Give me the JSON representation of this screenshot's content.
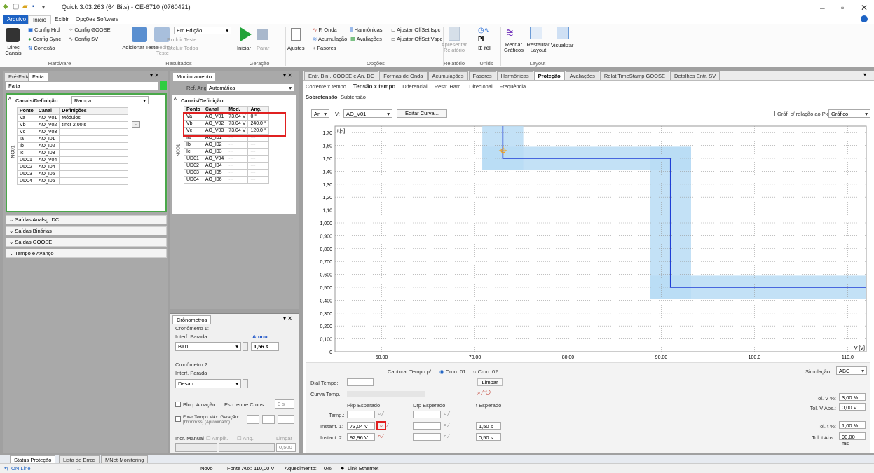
{
  "title_bar": {
    "title": "Quick 3.03.263 (64 Bits) - CE-6710 (0760421)"
  },
  "menu": {
    "items": [
      "Arquivo",
      "Início",
      "Exibir",
      "Opções Software"
    ]
  },
  "ribbon": {
    "hardware": {
      "config_hrd": "Config Hrd",
      "config_goose": "Config GOOSE",
      "config_sync": "Config Sync",
      "config_sv": "Config SV",
      "direc_canais": "Direc Canais",
      "conexao": "Conexão",
      "label": "Hardware"
    },
    "resultados": {
      "adicionar": "Adicionar Teste",
      "reeditar": "Reeditar Teste",
      "em_edicao": "Em Edição...",
      "excluir_teste": "Excluir Teste",
      "excluir_todos": "Excluir Todos",
      "label": "Resultados"
    },
    "geracao": {
      "iniciar": "Iniciar",
      "parar": "Parar",
      "label": "Geração"
    },
    "opcoes": {
      "ajustes": "Ajustes",
      "f_onda": "F. Onda",
      "acumulacao": "Acumulação",
      "fasores": "Fasores",
      "harmonicas": "Harmônicas",
      "avaliacoes": "Avaliações",
      "ajustar_ispc": "Ajustar OffSet Ispc",
      "ajustar_vspc": "Ajustar OffSet Vspc",
      "label": "Opções"
    },
    "relatorio": {
      "apresentar": "Apresentar Relatório",
      "label": "Relatório"
    },
    "unids": {
      "label": "Unids"
    },
    "layout": {
      "recriar": "Recriar Gráficos",
      "restaurar": "Restaurar Layout",
      "visualizar": "Visualizar",
      "label": "Layout"
    }
  },
  "left_panel": {
    "tabs": [
      "Pré-Falta",
      "Falta"
    ],
    "field_value": "Falta",
    "section": "Canais/Definição",
    "mode": "Rampa",
    "group_label": "NO01",
    "headers": [
      "Ponto",
      "Canal",
      "Definições"
    ],
    "rows": [
      [
        "Va",
        "AO_V01",
        "Módulos"
      ],
      [
        "Vb",
        "AO_V02",
        "tIncr 2,00 s"
      ],
      [
        "Vc",
        "AO_V03",
        ""
      ],
      [
        "Ia",
        "AO_I01",
        ""
      ],
      [
        "Ib",
        "AO_I02",
        ""
      ],
      [
        "Ic",
        "AO_I03",
        ""
      ],
      [
        "UD01",
        "AO_V04",
        ""
      ],
      [
        "UD02",
        "AO_I04",
        ""
      ],
      [
        "UD03",
        "AO_I05",
        ""
      ],
      [
        "UD04",
        "AO_I06",
        ""
      ]
    ],
    "collapsibles": [
      "Saídas Analsg. DC",
      "Saídas Binárias",
      "Saídas GOOSE",
      "Tempo e Avanço"
    ]
  },
  "monitor_panel": {
    "tab": "Monitoramento",
    "ref_label": "Ref. Ang.:",
    "ref_value": "Automática",
    "section": "Canais/Definição",
    "group_label": "NO01",
    "headers": [
      "Ponto",
      "Canal",
      "Mod.",
      "Ang."
    ],
    "rows": [
      [
        "Va",
        "AO_V01",
        "73,04 V",
        "0 °"
      ],
      [
        "Vb",
        "AO_V02",
        "73,04 V",
        "240,0 °"
      ],
      [
        "Vc",
        "AO_V03",
        "73,04 V",
        "120,0 °"
      ],
      [
        "Ia",
        "AO_I01",
        "---",
        "---"
      ],
      [
        "Ib",
        "AO_I02",
        "---",
        "---"
      ],
      [
        "Ic",
        "AO_I03",
        "---",
        "---"
      ],
      [
        "UD01",
        "AO_V04",
        "---",
        "---"
      ],
      [
        "UD02",
        "AO_I04",
        "---",
        "---"
      ],
      [
        "UD03",
        "AO_I05",
        "---",
        "---"
      ],
      [
        "UD04",
        "AO_I06",
        "---",
        "---"
      ]
    ]
  },
  "cronometros": {
    "tab": "Crônometros",
    "c1_title": "Cronômetro 1:",
    "c1_interf": "Interf. Parada",
    "c1_status": "Atuou",
    "c1_select": "BI01",
    "c1_time": "1,56 s",
    "c2_title": "Cronômetro 2:",
    "c2_interf": "Interf. Parada",
    "c2_select": "Desab.",
    "bloq": "Bloq. Atuação",
    "esp": "Esp. entre Crons.:",
    "esp_value": "0 s",
    "fixar": "Fixar Tempo Máx. Geração:",
    "fixar_fmt": "[hh:mm:ss] (Aproximado)",
    "incr": "Incr. Manual",
    "amplit": "Amplit.",
    "ang": "Ang.",
    "limpar": "Limpar",
    "step": "0,500"
  },
  "right_panel": {
    "tabs": [
      "Entr. Bin., GOOSE e An. DC",
      "Formas de Onda",
      "Acumulações",
      "Fasores",
      "Harmônicas",
      "Proteção",
      "Avaliações",
      "Relat TimeStamp GOOSE",
      "Detalhes Entr. SV"
    ],
    "subtabs": [
      "Corrente x tempo",
      "Tensão x tempo",
      "Diferencial",
      "Restr. Ham.",
      "Direcional",
      "Frequência"
    ],
    "subsub": [
      "Sobretensão",
      "Subtensão"
    ],
    "an_select": "An",
    "v_label": "V:",
    "v_select": "AO_V01",
    "edit_btn": "Editar Curva...",
    "graf_check": "Gráf. c/ relação ao Pkp Temp.",
    "graf_select": "Gráfico"
  },
  "chart_data": {
    "type": "line",
    "xlabel": "V [V]",
    "ylabel": "t [s]",
    "xlim": [
      55,
      112
    ],
    "ylim": [
      0,
      1.75
    ],
    "x_ticks": [
      "60,00",
      "70,00",
      "80,00",
      "90,00",
      "100,0",
      "110,0"
    ],
    "y_ticks": [
      "1,70",
      "1,60",
      "1,50",
      "1,40",
      "1,30",
      "1,20",
      "1,10",
      "1,000",
      "0,900",
      "0,800",
      "0,700",
      "0,600",
      "0,500",
      "0,400",
      "0,300",
      "0,200",
      "0,100",
      "0"
    ],
    "series": [
      {
        "x": [
          73,
          73,
          91,
          91,
          112
        ],
        "y": [
          1.75,
          1.5,
          1.5,
          0.5,
          0.5
        ],
        "color": "#1f3fd6"
      }
    ],
    "tolerance_bands": [
      {
        "x": [
          70.8,
          75.2
        ],
        "y": [
          1.41,
          1.75
        ]
      },
      {
        "x": [
          70.8,
          93.2
        ],
        "y": [
          1.41,
          1.59
        ]
      },
      {
        "x": [
          88.8,
          93.2
        ],
        "y": [
          0.41,
          1.59
        ]
      },
      {
        "x": [
          88.8,
          112
        ],
        "y": [
          0.41,
          0.59
        ]
      }
    ],
    "marker": {
      "x": 73.04,
      "y": 1.56
    }
  },
  "capture": {
    "dial_label": "Dial Tempo:",
    "curva_label": "Curva Temp.:",
    "capturar": "Capturar Tempo p/:",
    "cron1": "Cron. 01",
    "cron2": "Cron. 02",
    "limpar": "Limpar",
    "pkp": "Pkp Esperado",
    "drp": "Drp Esperado",
    "t_esp": "t Esperado",
    "temp": "Temp.:",
    "inst1": "Instant. 1:",
    "inst2": "Instant. 2:",
    "inst1_pkp": "73,04 V",
    "inst2_pkp": "92,96 V",
    "inst1_t": "1,50 s",
    "inst2_t": "0,50 s",
    "simulacao": "Simulação:",
    "sim_value": "ABC",
    "tolv_pct": "Tol. V %:",
    "tolv_pct_val": "3,00 %",
    "tolv_abs": "Tol. V Abs.:",
    "tolv_abs_val": "0,00 V",
    "tolt_pct": "Tol. t %:",
    "tolt_pct_val": "1,00 %",
    "tolt_abs": "Tol. t Abs.:",
    "tolt_abs_val": "90,00 ms"
  },
  "bottom_tabs": [
    "Status Proteção",
    "Lista de Erros",
    "MNet-Monitoring"
  ],
  "status": {
    "online": "ON Line",
    "dots": "...",
    "novo": "Novo",
    "fonte": "Fonte Aux: 110,00 V",
    "aquec": "Aquecimento:",
    "aquec_val": "0%",
    "link": "Link Ethernet"
  }
}
